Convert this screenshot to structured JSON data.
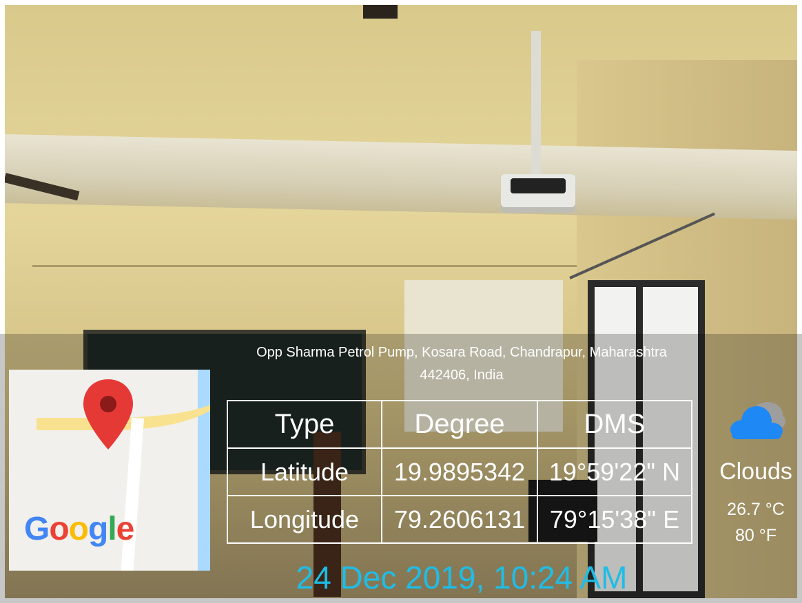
{
  "address": {
    "line1": "Opp Sharma Petrol Pump, Kosara Road, Chandrapur, Maharashtra",
    "line2": "442406, India"
  },
  "map": {
    "logo_letters": [
      "G",
      "o",
      "o",
      "g",
      "l",
      "e"
    ],
    "logo_colors": [
      "#4285f4",
      "#ea4335",
      "#fbbc05",
      "#4285f4",
      "#34a853",
      "#ea4335"
    ],
    "pin_color": "#e53935"
  },
  "coordinates_table": {
    "headers": [
      "Type",
      "Degree",
      "DMS"
    ],
    "rows": [
      [
        "Latitude",
        "19.9895342",
        "19°59'22\" N"
      ],
      [
        "Longitude",
        "79.2606131",
        "79°15'38\" E"
      ]
    ]
  },
  "weather": {
    "icon": "cloud-icon",
    "condition": "Clouds",
    "temp_c": "26.7 °C",
    "temp_f": "80 °F",
    "icon_color": "#1e88f5"
  },
  "timestamp": {
    "text": "24 Dec 2019, 10:24 AM",
    "color": "#1fbde6"
  }
}
